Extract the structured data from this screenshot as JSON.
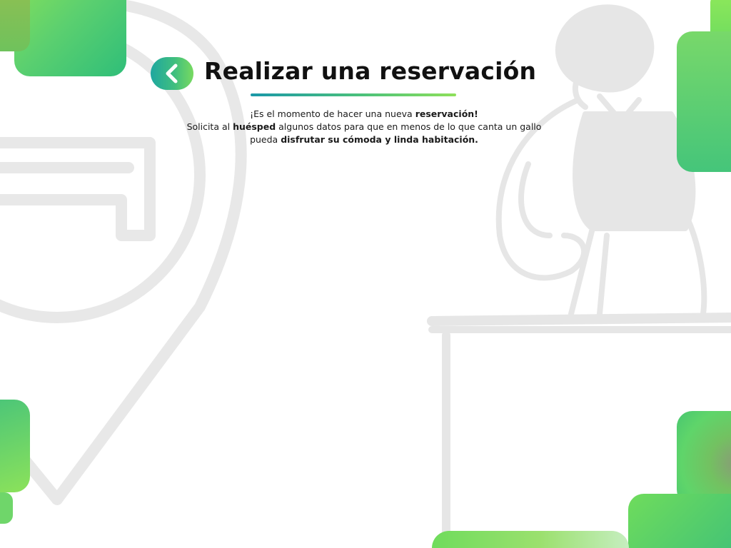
{
  "page": {
    "title": "Realizar una reservación",
    "back_label": "",
    "intro": {
      "line1_a": "¡Es el momento de hacer una nueva ",
      "line1_b": "reservación!",
      "line2_a": "Solicita al ",
      "line2_b": "huésped",
      "line2_c": " algunos datos para que en menos de lo que canta un gallo",
      "line3_a": "pueda ",
      "line3_b": "disfrutar su cómoda y linda habitación."
    }
  },
  "icons": {
    "back": "chevron-left-icon"
  },
  "colors": {
    "accent_teal": "#1fa7a0",
    "accent_green": "#78da60",
    "text": "#111111",
    "illustration_gray": "#e6e6e6"
  }
}
